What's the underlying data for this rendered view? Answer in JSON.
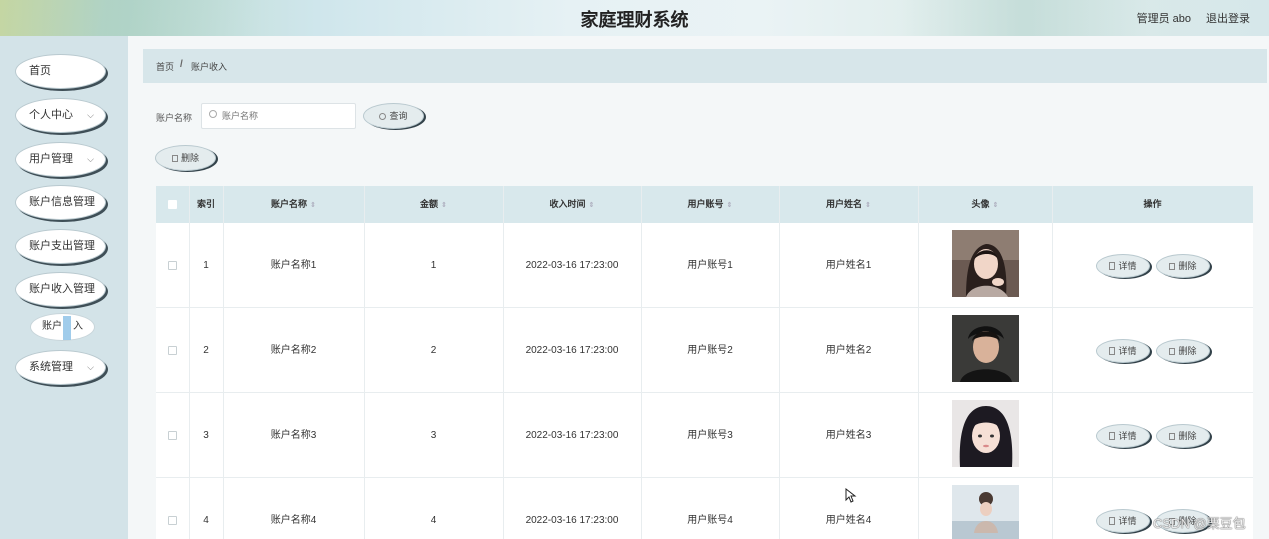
{
  "header": {
    "title": "家庭理财系统",
    "admin": "管理员 abo",
    "logout": "退出登录"
  },
  "sidebar": {
    "items": [
      {
        "label": "首页",
        "has_chevron": false
      },
      {
        "label": "个人中心",
        "has_chevron": true
      },
      {
        "label": "用户管理",
        "has_chevron": true
      },
      {
        "label": "账户信息管理",
        "has_chevron": false
      },
      {
        "label": "账户支出管理",
        "has_chevron": false
      },
      {
        "label": "账户收入管理",
        "has_chevron": false
      },
      {
        "label": "系统管理",
        "has_chevron": true
      }
    ],
    "sub_item_parts": [
      "账户",
      "入"
    ],
    "chevron": "⌵"
  },
  "breadcrumb": {
    "home": "首页",
    "separator": "/",
    "current": "账户收入"
  },
  "search": {
    "label": "账户名称",
    "placeholder": "账户名称",
    "query_button": "查询",
    "delete_button": "删除"
  },
  "table": {
    "columns": [
      "索引",
      "账户名称",
      "金额",
      "收入时间",
      "用户账号",
      "用户姓名",
      "头像",
      "操作"
    ],
    "sortable": [
      "账户名称",
      "金额",
      "收入时间",
      "用户账号",
      "用户姓名",
      "头像"
    ],
    "sort_icon": "⇕",
    "rows": [
      {
        "index": "1",
        "account_name": "账户名称1",
        "amount": "1",
        "income_time": "2022-03-16 17:23:00",
        "user_account": "用户账号1",
        "user_name": "用户姓名1"
      },
      {
        "index": "2",
        "account_name": "账户名称2",
        "amount": "2",
        "income_time": "2022-03-16 17:23:00",
        "user_account": "用户账号2",
        "user_name": "用户姓名2"
      },
      {
        "index": "3",
        "account_name": "账户名称3",
        "amount": "3",
        "income_time": "2022-03-16 17:23:00",
        "user_account": "用户账号3",
        "user_name": "用户姓名3"
      },
      {
        "index": "4",
        "account_name": "账户名称4",
        "amount": "4",
        "income_time": "2022-03-16 17:23:00",
        "user_account": "用户账号4",
        "user_name": "用户姓名4"
      }
    ],
    "detail_button": "详情",
    "delete_button": "删除"
  },
  "watermark": "CSDN @栗豆包",
  "colors": {
    "sidebar_bg": "#d3e3e8",
    "breadcrumb_bg": "#d7e6ea",
    "table_header_bg": "#d8e8ec",
    "button_shadow": "#33424a"
  }
}
